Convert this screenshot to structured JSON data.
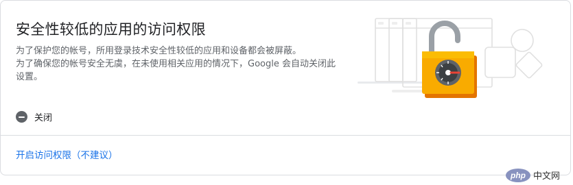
{
  "card": {
    "title": "安全性较低的应用的访问权限",
    "description_line1": "为了保护您的帐号，所用登录技术安全性较低的应用和设备都会被屏蔽。",
    "description_line2": "为了确保您的帐号安全无虞，在未使用相关应用的情况下，Google 会自动关闭此设置。"
  },
  "status": {
    "label": "关闭",
    "icon": "minus-circle-icon"
  },
  "action": {
    "label": "开启访问权限（不建议）"
  },
  "illustration": {
    "icon": "unlocked-padlock-icon"
  },
  "watermark": {
    "logo_text": "php",
    "site_text": "中文网"
  },
  "colors": {
    "title": "#202124",
    "description": "#5f6368",
    "link": "#1a73e8",
    "lock_body": "#f9ab00",
    "border": "#dadce0"
  }
}
